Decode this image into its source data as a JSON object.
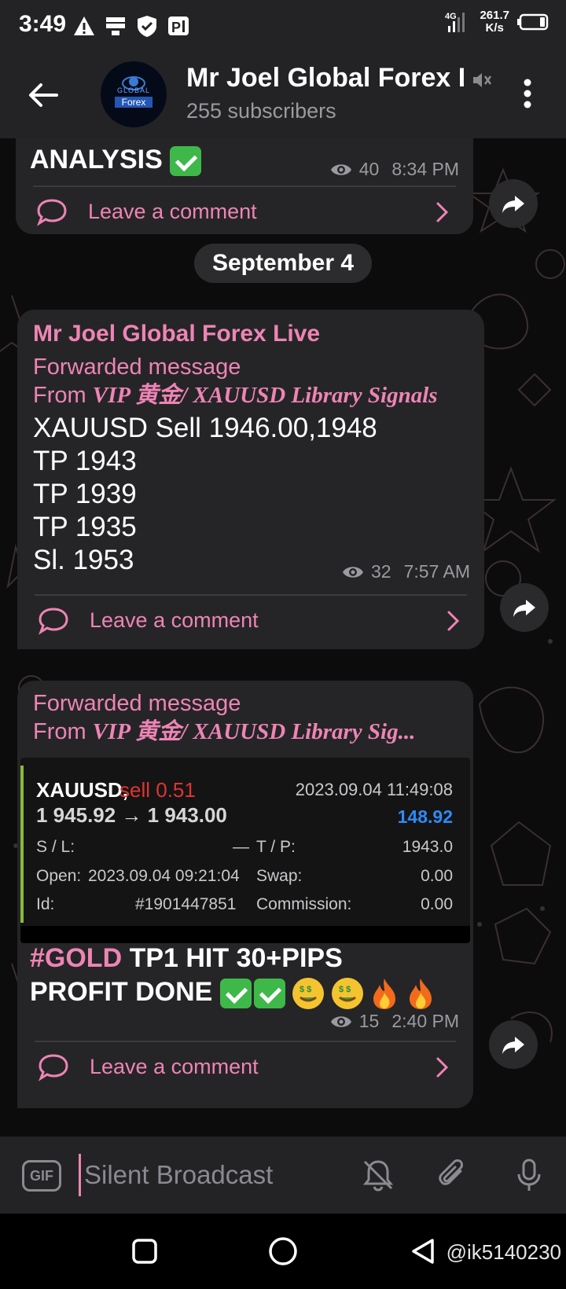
{
  "status_bar": {
    "time": "3:49",
    "network": "4G",
    "speed_value": "261.7",
    "speed_unit": "K/s"
  },
  "header": {
    "channel_name": "Mr Joel Global Forex Live",
    "subscribers": "255 subscribers",
    "avatar_text_top": "GLOBAL",
    "avatar_text_bottom": "Forex"
  },
  "messages": [
    {
      "text_tail": "ANALYSIS",
      "views": "40",
      "time": "8:34 PM",
      "comment_label": "Leave a comment"
    },
    {
      "author": "Mr Joel Global Forex Live",
      "forwarded_label": "Forwarded message",
      "from_prefix": "From",
      "from_source": "VIP 黄金/ XAUUSD Library Signals",
      "lines": [
        "XAUUSD Sell 1946.00,1948",
        "TP 1943",
        "TP 1939",
        "TP 1935",
        "Sl. 1953"
      ],
      "views": "32",
      "time": "7:57 AM",
      "comment_label": "Leave a comment"
    },
    {
      "forwarded_label": "Forwarded message",
      "from_prefix": "From",
      "from_source": "VIP 黄金/ XAUUSD Library Sig...",
      "hashtag": "#GOLD",
      "line1_rest": "TP1 HIT 30+PIPS",
      "line2": "PROFIT DONE",
      "views": "15",
      "time": "2:40 PM",
      "comment_label": "Leave a comment"
    }
  ],
  "date_separator": "September 4",
  "trade_card": {
    "symbol": "XAUUSD,",
    "side": "sell 0.51",
    "datetime": "2023.09.04 11:49:08",
    "prices": "1 945.92 → 1 943.00",
    "profit": "148.92",
    "sl_label": "S / L:",
    "sl_value": "—",
    "tp_label": "T / P:",
    "tp_value": "1943.0",
    "open_label": "Open:",
    "open_value": "2023.09.04 09:21:04",
    "swap_label": "Swap:",
    "swap_value": "0.00",
    "id_label": "Id:",
    "id_value": "#1901447851",
    "commission_label": "Commission:",
    "commission_value": "0.00"
  },
  "input_bar": {
    "gif_label": "GIF",
    "placeholder": "Silent Broadcast"
  },
  "watermark": "@ik5140230",
  "colors": {
    "accent_pink": "#ee84b5",
    "bubble": "#252527",
    "header": "#232325",
    "sell_red": "#e0342f",
    "profit_blue": "#2f8af5"
  }
}
